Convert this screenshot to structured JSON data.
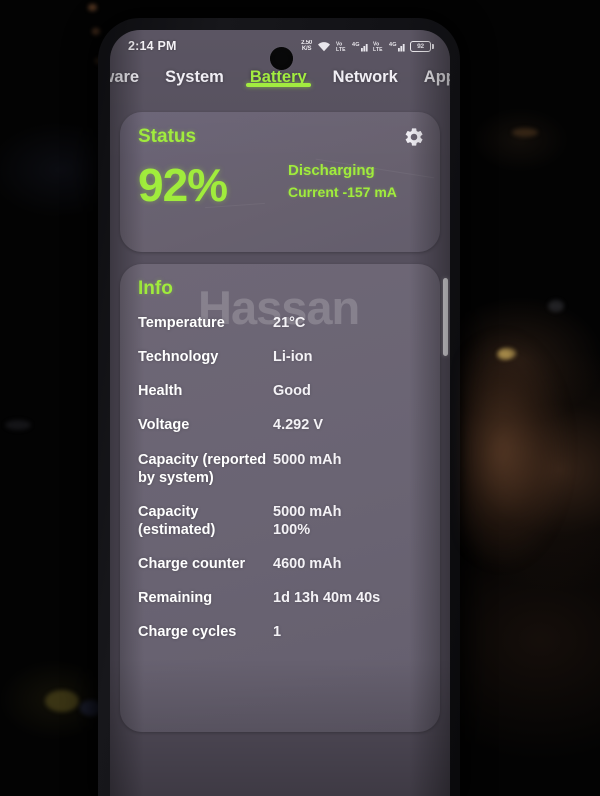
{
  "statusbar": {
    "clock": "2:14 PM",
    "netspeed_top": "2.50",
    "netspeed_bottom": "K/S",
    "icons": [
      {
        "name": "network-speed-icon",
        "label": "2.50 K/S"
      },
      {
        "name": "wifi-icon",
        "label": "Wi-Fi"
      },
      {
        "name": "mobile-data-lte-icon",
        "label": "VoLTE"
      },
      {
        "name": "signal-4g-sim1-icon",
        "label": "4G"
      },
      {
        "name": "mobile-data-lte2-icon",
        "label": "VoLTE"
      },
      {
        "name": "signal-4g-sim2-icon",
        "label": "4G"
      }
    ],
    "battery_level": "92"
  },
  "tabs": [
    {
      "label": "rdware",
      "name": "tab-hardware",
      "active": false
    },
    {
      "label": "System",
      "name": "tab-system",
      "active": false
    },
    {
      "label": "Battery",
      "name": "tab-battery",
      "active": true
    },
    {
      "label": "Network",
      "name": "tab-network",
      "active": false
    },
    {
      "label": "App",
      "name": "tab-apps",
      "active": false
    }
  ],
  "status_card": {
    "title": "Status",
    "percent": "92%",
    "state": "Discharging",
    "current": "Current -157 mA",
    "settings_icon": "gear-icon"
  },
  "info_card": {
    "title": "Info",
    "watermark": "Hassan",
    "rows": [
      {
        "label": "Temperature",
        "value": "21°C",
        "sub": ""
      },
      {
        "label": "Technology",
        "value": "Li-ion",
        "sub": ""
      },
      {
        "label": "Health",
        "value": "Good",
        "sub": ""
      },
      {
        "label": "Voltage",
        "value": "4.292 V",
        "sub": ""
      },
      {
        "label": "Capacity (reported by system)",
        "value": "5000 mAh",
        "sub": ""
      },
      {
        "label": "Capacity (estimated)",
        "value": "5000 mAh",
        "sub": "100%"
      },
      {
        "label": "Charge counter",
        "value": "4600 mAh",
        "sub": ""
      },
      {
        "label": "Remaining",
        "value": "1d 13h 40m 40s",
        "sub": ""
      },
      {
        "label": "Charge cycles",
        "value": "1",
        "sub": ""
      }
    ]
  },
  "colors": {
    "accent_green": "#a0ec3c",
    "app_background": "#56505e",
    "card_status": "#6b6477",
    "card_info": "#6e6776",
    "text_primary": "#ffffff"
  }
}
